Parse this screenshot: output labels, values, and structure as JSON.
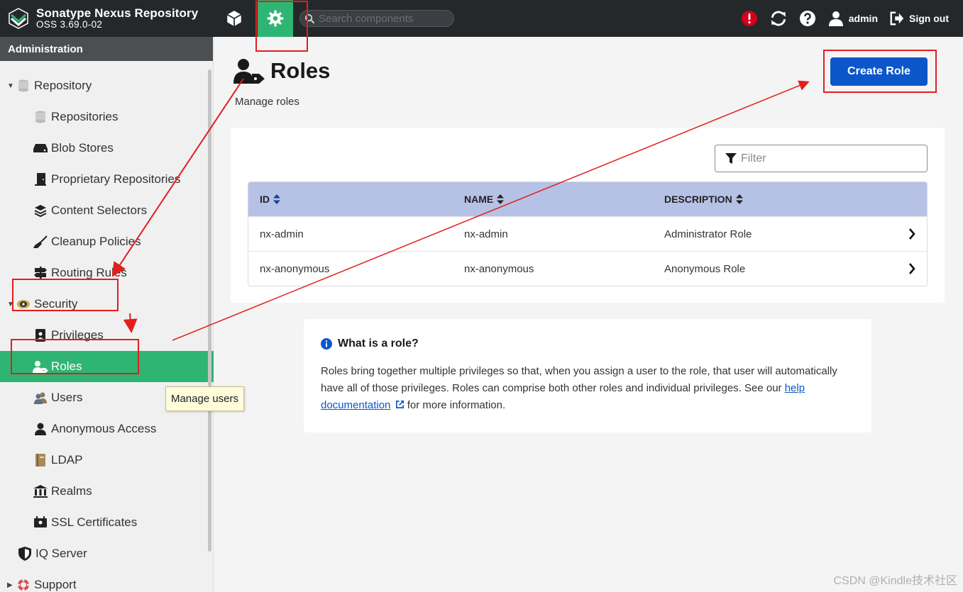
{
  "header": {
    "brand_name": "Sonatype Nexus Repository",
    "brand_version": "OSS 3.69.0-02",
    "search_placeholder": "Search components",
    "user_label": "admin",
    "signout_label": "Sign out"
  },
  "sidebar": {
    "title": "Administration",
    "items": [
      {
        "label": "Repository",
        "icon": "database-icon"
      },
      {
        "label": "Repositories",
        "icon": "database-icon"
      },
      {
        "label": "Blob Stores",
        "icon": "hard-drive-icon"
      },
      {
        "label": "Proprietary Repositories",
        "icon": "door-icon"
      },
      {
        "label": "Content Selectors",
        "icon": "layers-icon"
      },
      {
        "label": "Cleanup Policies",
        "icon": "broom-icon"
      },
      {
        "label": "Routing Rules",
        "icon": "signpost-icon"
      },
      {
        "label": "Security",
        "icon": "eye-badge-icon"
      },
      {
        "label": "Privileges",
        "icon": "id-badge-icon"
      },
      {
        "label": "Roles",
        "icon": "user-tag-icon"
      },
      {
        "label": "Users",
        "icon": "users-icon"
      },
      {
        "label": "Anonymous Access",
        "icon": "user-icon"
      },
      {
        "label": "LDAP",
        "icon": "book-icon"
      },
      {
        "label": "Realms",
        "icon": "realms-icon"
      },
      {
        "label": "SSL Certificates",
        "icon": "certificate-icon"
      },
      {
        "label": "IQ Server",
        "icon": "shield-icon"
      },
      {
        "label": "Support",
        "icon": "lifebuoy-icon"
      }
    ]
  },
  "main": {
    "title": "Roles",
    "subtitle": "Manage roles",
    "create_button": "Create Role",
    "filter_placeholder": "Filter",
    "columns": [
      "ID",
      "NAME",
      "DESCRIPTION"
    ],
    "rows": [
      {
        "id": "nx-admin",
        "name": "nx-admin",
        "description": "Administrator Role"
      },
      {
        "id": "nx-anonymous",
        "name": "nx-anonymous",
        "description": "Anonymous Role"
      }
    ],
    "info_title": "What is a role?",
    "info_text_1": "Roles bring together multiple privileges so that, when you assign a user to the role, that user will automatically have all of those privileges. Roles can comprise both other roles and individual privileges. See our ",
    "info_link": "help documentation",
    "info_text_2": " for more information."
  },
  "tooltip": "Manage users",
  "watermark": "CSDN @Kindle技术社区",
  "colors": {
    "header_bg": "#25282b",
    "accent_green": "#2fb573",
    "primary_blue": "#0b57c9",
    "table_header": "#b6c1e6",
    "annotation_red": "#e41d1d",
    "alert_red": "#d0021b"
  }
}
